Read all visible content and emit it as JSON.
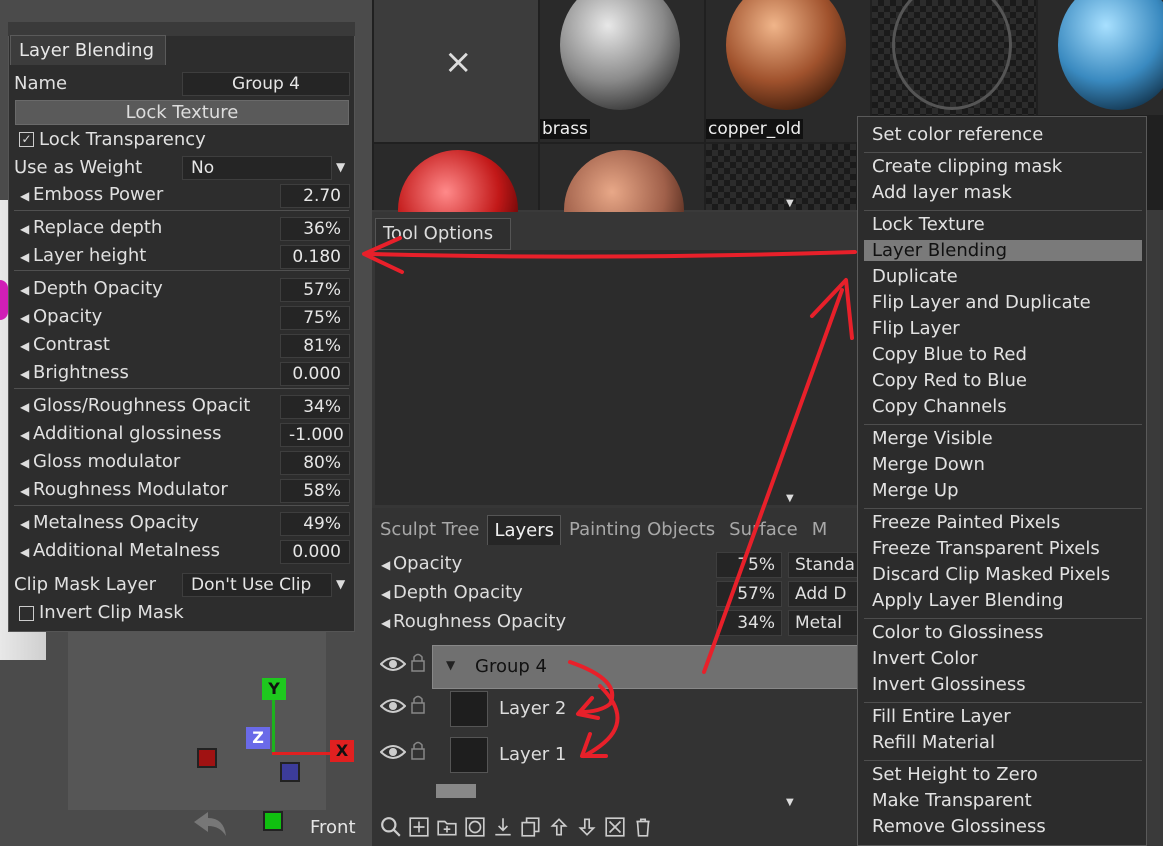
{
  "viewport": {
    "view_label": "Front",
    "gizmo": {
      "x": "X",
      "y": "Y",
      "z": "Z"
    }
  },
  "layer_blending": {
    "tab": "Layer Blending",
    "name_label": "Name",
    "name_value": "Group 4",
    "lock_texture_btn": "Lock Texture",
    "lock_transparency": "Lock Transparency",
    "use_as_weight_label": "Use as Weight",
    "use_as_weight_value": "No",
    "params": [
      {
        "label": "Emboss Power",
        "value": "2.70"
      },
      {
        "label": "Replace depth",
        "value": "36%"
      },
      {
        "label": "Layer height",
        "value": "0.180"
      },
      {
        "label": "Depth Opacity",
        "value": "57%"
      },
      {
        "label": "Opacity",
        "value": "75%"
      },
      {
        "label": "Contrast",
        "value": "81%"
      },
      {
        "label": "Brightness",
        "value": "0.000"
      },
      {
        "label": "Gloss/Roughness Opacit",
        "value": "34%"
      },
      {
        "label": "Additional glossiness",
        "value": "-1.000"
      },
      {
        "label": "Gloss modulator",
        "value": "80%"
      },
      {
        "label": "Roughness Modulator",
        "value": "58%"
      },
      {
        "label": "Metalness Opacity",
        "value": "49%"
      },
      {
        "label": "Additional Metalness",
        "value": "0.000"
      }
    ],
    "clip_mask_label": "Clip Mask Layer",
    "clip_mask_value": "Don't Use Clip",
    "invert_clip_mask": "Invert Clip Mask"
  },
  "materials": {
    "close": "×",
    "items": [
      "brass",
      "copper_old"
    ]
  },
  "tool_options": {
    "tab": "Tool Options"
  },
  "layers_panel": {
    "tabs": [
      "Sculpt Tree",
      "Layers",
      "Painting Objects",
      "Surface",
      "M"
    ],
    "rows": [
      {
        "label": "Opacity",
        "value": "75%",
        "mode": "Standa"
      },
      {
        "label": "Depth Opacity",
        "value": "57%",
        "mode": "Add D"
      },
      {
        "label": "Roughness Opacity",
        "value": "34%",
        "mode": "Metal"
      }
    ],
    "layers": [
      {
        "name": "Group 4"
      },
      {
        "name": "Layer 2"
      },
      {
        "name": "Layer 1"
      }
    ]
  },
  "context_menu": {
    "groups": [
      [
        "Set color reference"
      ],
      [
        "Create clipping mask",
        "Add layer mask"
      ],
      [
        "Lock Texture",
        "Layer Blending",
        "Duplicate",
        "Flip Layer and Duplicate",
        "Flip Layer",
        "Copy Blue to Red",
        "Copy Red to Blue",
        "Copy Channels"
      ],
      [
        "Merge Visible",
        "Merge Down",
        "Merge Up"
      ],
      [
        "Freeze Painted Pixels",
        "Freeze Transparent Pixels",
        "Discard Clip Masked Pixels",
        "Apply Layer Blending"
      ],
      [
        "Color to Glossiness",
        "Invert Color",
        "Invert Glossiness"
      ],
      [
        "Fill Entire Layer",
        "Refill Material"
      ],
      [
        "Set Height to Zero",
        "Make Transparent",
        "Remove Glossiness"
      ]
    ],
    "highlighted": "Layer Blending"
  },
  "annotation_color": "#e8202a"
}
